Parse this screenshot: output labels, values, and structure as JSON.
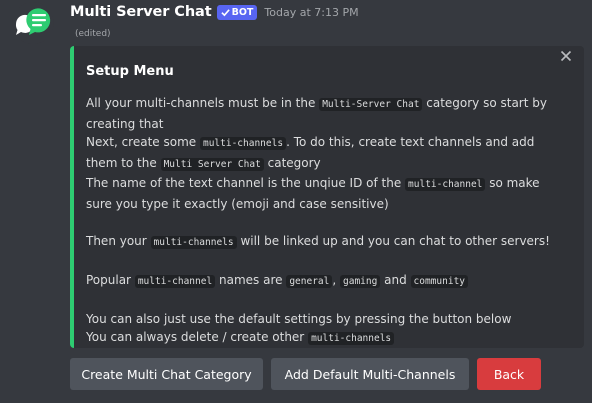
{
  "message": {
    "username": "Multi Server Chat",
    "bot_tag": "BOT",
    "timestamp": "Today at 7:13 PM",
    "edited": "(edited)"
  },
  "embed": {
    "accent_color": "#2ecc71",
    "title": "Setup Menu",
    "line1": {
      "a": "All your multi-channels must be in the ",
      "code1": "Multi-Server Chat",
      "b": " category so start by creating that"
    },
    "line2": {
      "a": "Next, create some ",
      "code1": "multi-channels",
      "b": ". To do this, create text channels and add them to the ",
      "code2": "Multi Server Chat",
      "c": " category"
    },
    "line3": {
      "a": "The name of the text channel is the unqiue ID of the ",
      "code1": "multi-channel",
      "b": " so make sure you type it exactly (emoji and case sensitive)"
    },
    "line4": {
      "a": "Then your ",
      "code1": "multi-channels",
      "b": " will be linked up and you can chat to other servers!"
    },
    "line5": {
      "a": "Popular ",
      "code1": "multi-channel",
      "b": " names are ",
      "code2": "general",
      "c": ", ",
      "code3": "gaming",
      "d": " and ",
      "code4": "community"
    },
    "line6": {
      "a": "You can also just use the default settings by pressing the button below"
    },
    "line7": {
      "a": "You can always delete / create other ",
      "code1": "multi-channels"
    }
  },
  "buttons": {
    "create_category": "Create Multi Chat Category",
    "add_default": "Add Default Multi-Channels",
    "back": "Back"
  },
  "colors": {
    "background": "#36393f",
    "embed_background": "#2f3136",
    "bot_tag": "#5865f2",
    "secondary_button": "#4f545c",
    "danger_button": "#d83c3e",
    "avatar": "#2ecc71"
  }
}
